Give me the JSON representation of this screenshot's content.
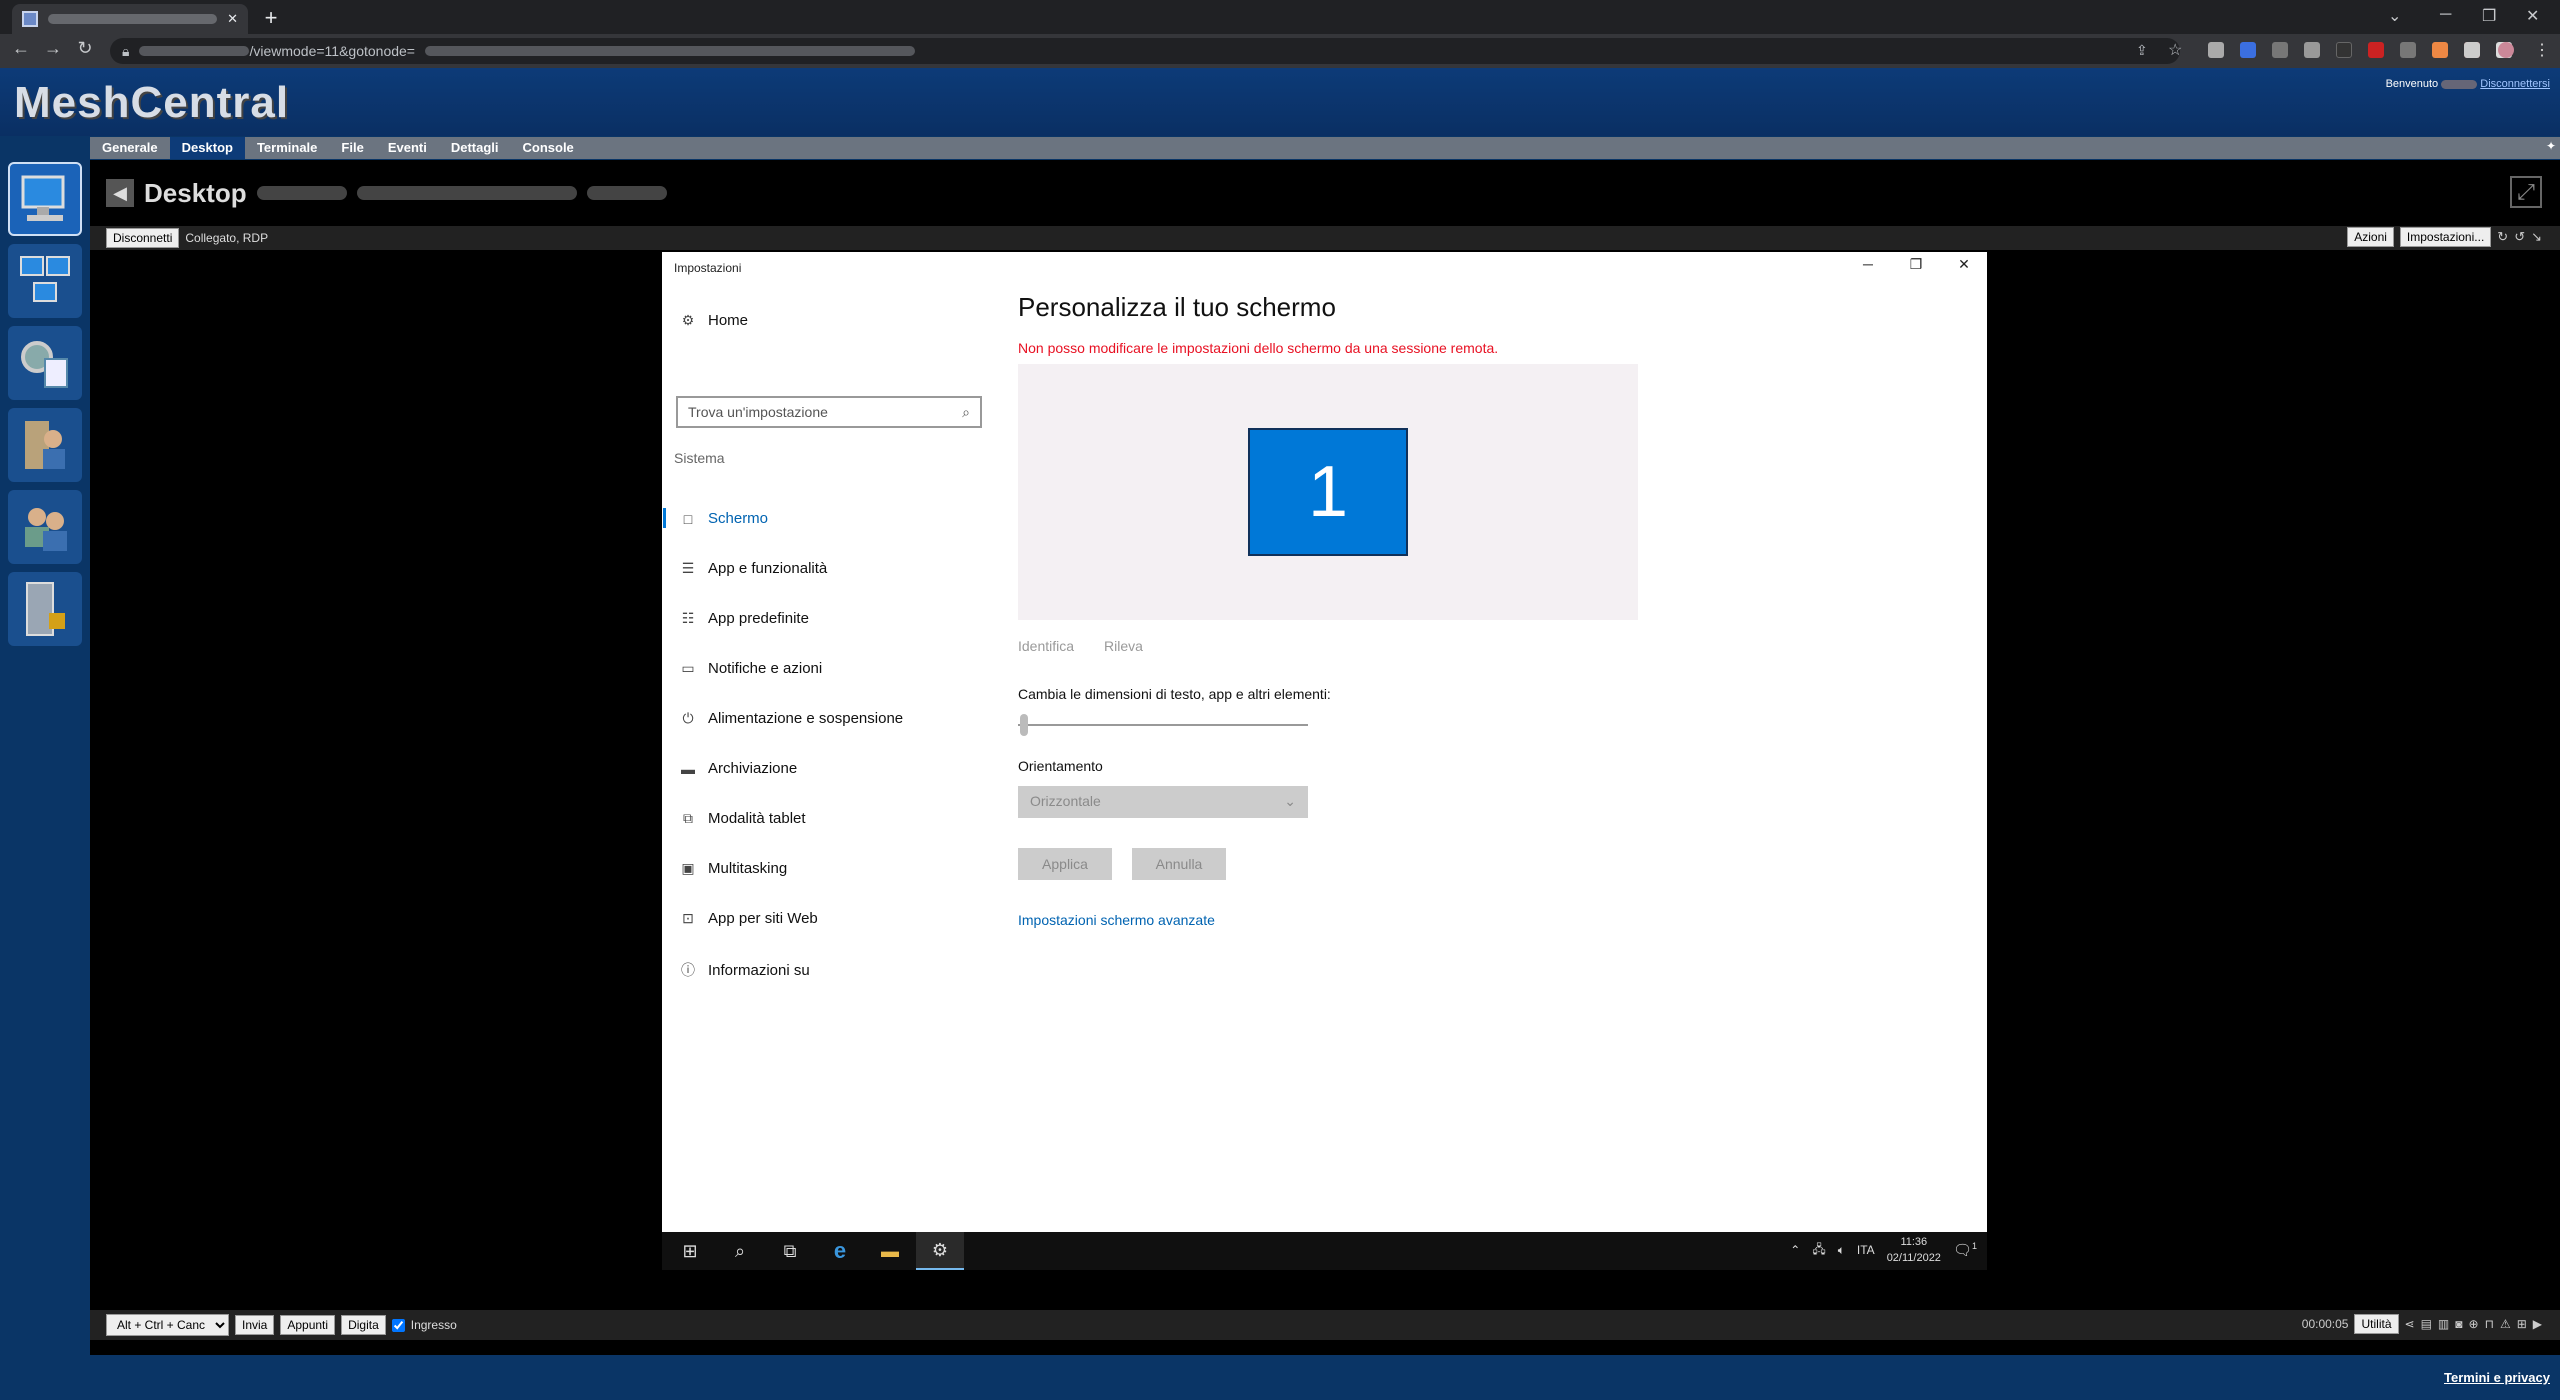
{
  "browser": {
    "url_fragment": "/viewmode=11&gotonode=",
    "new_tab": "+"
  },
  "header": {
    "logo": "MeshCentral",
    "welcome": "Benvenuto",
    "logout": "Disconnettersi"
  },
  "nav": {
    "tabs": [
      "Generale",
      "Desktop",
      "Terminale",
      "File",
      "Eventi",
      "Dettagli",
      "Console"
    ],
    "active": "Desktop"
  },
  "desktop": {
    "title": "Desktop",
    "disconnect": "Disconnetti",
    "status": "Collegato, RDP",
    "actions": "Azioni",
    "settings": "Impostazioni..."
  },
  "remote": {
    "window_title": "Impostazioni",
    "home": "Home",
    "search_placeholder": "Trova un'impostazione",
    "section": "Sistema",
    "nav_items": [
      {
        "label": "Schermo",
        "icon": "□"
      },
      {
        "label": "App e funzionalità",
        "icon": "☰"
      },
      {
        "label": "App predefinite",
        "icon": "☷"
      },
      {
        "label": "Notifiche e azioni",
        "icon": "▭"
      },
      {
        "label": "Alimentazione e sospensione",
        "icon": "⏻"
      },
      {
        "label": "Archiviazione",
        "icon": "▬"
      },
      {
        "label": "Modalità tablet",
        "icon": "⧉"
      },
      {
        "label": "Multitasking",
        "icon": "▣"
      },
      {
        "label": "App per siti Web",
        "icon": "⊡"
      },
      {
        "label": "Informazioni su",
        "icon": "ⓘ"
      }
    ],
    "page_title": "Personalizza il tuo schermo",
    "warning": "Non posso modificare le impostazioni dello schermo da una sessione remota.",
    "monitor_number": "1",
    "identify": "Identifica",
    "detect": "Rileva",
    "scale_label": "Cambia le dimensioni di testo, app e altri elementi:",
    "orientation_label": "Orientamento",
    "orientation_value": "Orizzontale",
    "apply": "Applica",
    "cancel": "Annulla",
    "advanced_link": "Impostazioni schermo avanzate",
    "taskbar": {
      "lang": "ITA",
      "time": "11:36",
      "date": "02/11/2022",
      "notif_count": "1"
    }
  },
  "bottom": {
    "keys_select": "Alt + Ctrl + Canc",
    "send": "Invia",
    "clipboard": "Appunti",
    "type": "Digita",
    "input_label": "Ingresso",
    "session_time": "00:00:05",
    "tools": "Utilità"
  },
  "footer": {
    "terms": "Termini e privacy"
  },
  "colors": {
    "mesh_blue": "#0d3b78",
    "win_accent": "#0078d7",
    "warning_red": "#e81123"
  }
}
